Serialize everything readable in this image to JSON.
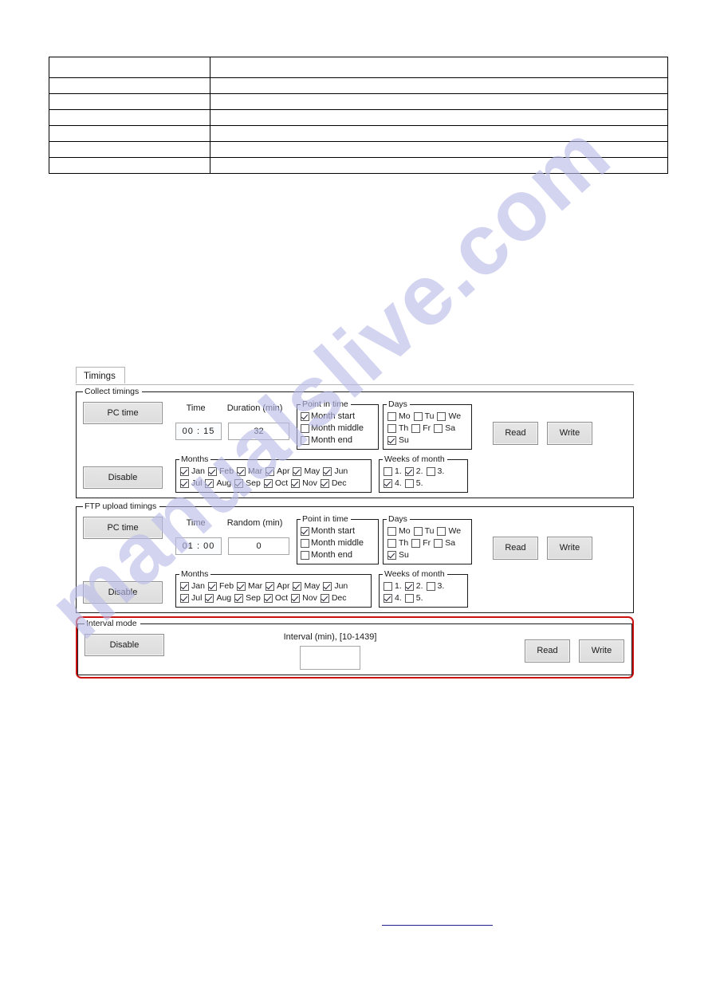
{
  "watermark": {
    "text": "manualslive.com",
    "color": "#b9bbe8"
  },
  "doc_table": {
    "rows": [
      {
        "c1": "",
        "c2": ""
      },
      {
        "c1": "",
        "c2": ""
      },
      {
        "c1": "",
        "c2": ""
      },
      {
        "c1": "",
        "c2": ""
      },
      {
        "c1": "",
        "c2": ""
      },
      {
        "c1": "",
        "c2": ""
      },
      {
        "c1": "",
        "c2": ""
      }
    ]
  },
  "app": {
    "tab": {
      "label": "Timings"
    },
    "collect": {
      "legend": "Collect timings",
      "pc_time_label": "PC time",
      "disable_label": "Disable",
      "time_label": "Time",
      "duration_label": "Duration (min)",
      "time_value": "00 : 15",
      "duration_value": "32",
      "read_label": "Read",
      "write_label": "Write",
      "point_in_time": {
        "legend": "Point in time",
        "items": [
          {
            "label": "Month start",
            "checked": true
          },
          {
            "label": "Month middle",
            "checked": false
          },
          {
            "label": "Month end",
            "checked": false
          }
        ]
      },
      "days": {
        "legend": "Days",
        "items": [
          {
            "label": "Mo",
            "checked": false
          },
          {
            "label": "Tu",
            "checked": false
          },
          {
            "label": "We",
            "checked": false
          },
          {
            "label": "Th",
            "checked": false
          },
          {
            "label": "Fr",
            "checked": false
          },
          {
            "label": "Sa",
            "checked": false
          },
          {
            "label": "Su",
            "checked": true
          }
        ]
      },
      "months": {
        "legend": "Months",
        "items": [
          {
            "label": "Jan",
            "checked": true
          },
          {
            "label": "Feb",
            "checked": true
          },
          {
            "label": "Mar",
            "checked": true
          },
          {
            "label": "Apr",
            "checked": true
          },
          {
            "label": "May",
            "checked": true
          },
          {
            "label": "Jun",
            "checked": true
          },
          {
            "label": "Jul",
            "checked": true
          },
          {
            "label": "Aug",
            "checked": true
          },
          {
            "label": "Sep",
            "checked": true
          },
          {
            "label": "Oct",
            "checked": true
          },
          {
            "label": "Nov",
            "checked": true
          },
          {
            "label": "Dec",
            "checked": true
          }
        ]
      },
      "weeks": {
        "legend": "Weeks of month",
        "items": [
          {
            "label": "1.",
            "checked": false
          },
          {
            "label": "2.",
            "checked": true
          },
          {
            "label": "3.",
            "checked": false
          },
          {
            "label": "4.",
            "checked": true
          },
          {
            "label": "5.",
            "checked": false
          }
        ]
      }
    },
    "ftp": {
      "legend": "FTP upload timings",
      "pc_time_label": "PC time",
      "disable_label": "Disable",
      "time_label": "Time",
      "random_label": "Random (min)",
      "time_value": "01 : 00",
      "random_value": "0",
      "read_label": "Read",
      "write_label": "Write",
      "point_in_time": {
        "legend": "Point in time",
        "items": [
          {
            "label": "Month start",
            "checked": true
          },
          {
            "label": "Month middle",
            "checked": false
          },
          {
            "label": "Month end",
            "checked": false
          }
        ]
      },
      "days": {
        "legend": "Days",
        "items": [
          {
            "label": "Mo",
            "checked": false
          },
          {
            "label": "Tu",
            "checked": false
          },
          {
            "label": "We",
            "checked": false
          },
          {
            "label": "Th",
            "checked": false
          },
          {
            "label": "Fr",
            "checked": false
          },
          {
            "label": "Sa",
            "checked": false
          },
          {
            "label": "Su",
            "checked": true
          }
        ]
      },
      "months": {
        "legend": "Months",
        "items": [
          {
            "label": "Jan",
            "checked": true
          },
          {
            "label": "Feb",
            "checked": true
          },
          {
            "label": "Mar",
            "checked": true
          },
          {
            "label": "Apr",
            "checked": true
          },
          {
            "label": "May",
            "checked": true
          },
          {
            "label": "Jun",
            "checked": true
          },
          {
            "label": "Jul",
            "checked": true
          },
          {
            "label": "Aug",
            "checked": true
          },
          {
            "label": "Sep",
            "checked": true
          },
          {
            "label": "Oct",
            "checked": true
          },
          {
            "label": "Nov",
            "checked": true
          },
          {
            "label": "Dec",
            "checked": true
          }
        ]
      },
      "weeks": {
        "legend": "Weeks of month",
        "items": [
          {
            "label": "1.",
            "checked": false
          },
          {
            "label": "2.",
            "checked": true
          },
          {
            "label": "3.",
            "checked": false
          },
          {
            "label": "4.",
            "checked": true
          },
          {
            "label": "5.",
            "checked": false
          }
        ]
      }
    },
    "interval": {
      "legend": "Interval mode",
      "disable_label": "Disable",
      "interval_label": "Interval (min), [10-1439]",
      "interval_value": "",
      "read_label": "Read",
      "write_label": "Write",
      "highlight_color": "#cc1111"
    }
  }
}
